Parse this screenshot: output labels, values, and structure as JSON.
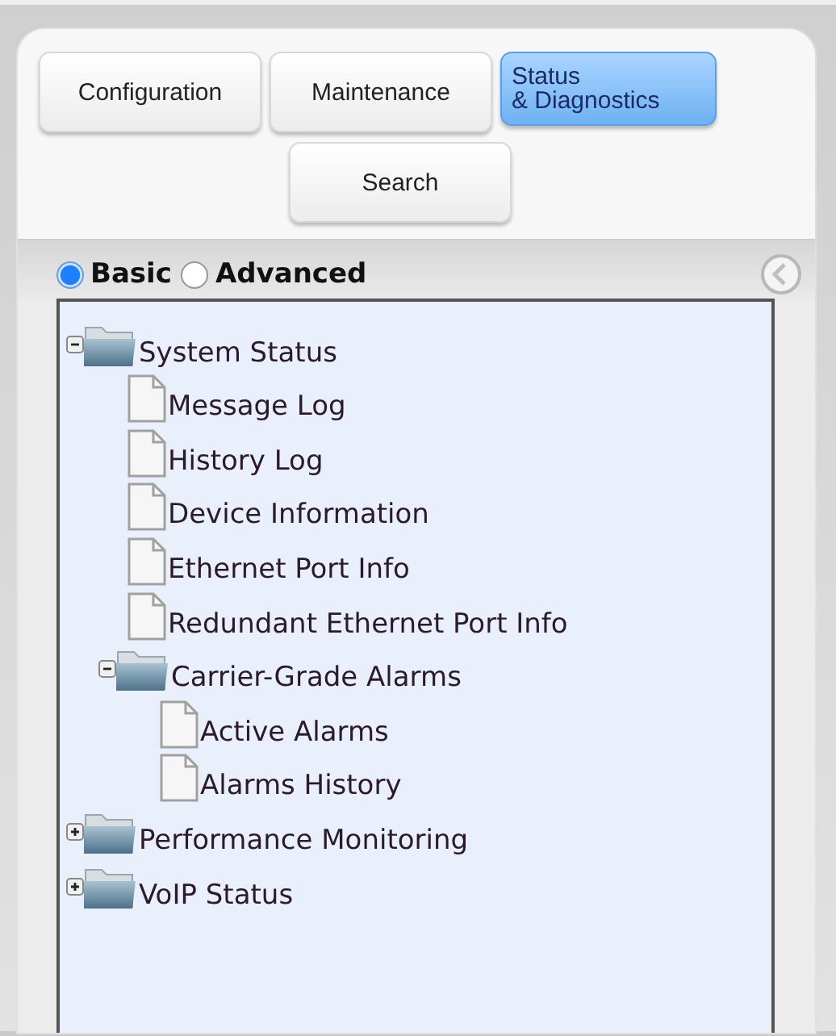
{
  "nav_buttons": [
    {
      "label": "Configuration",
      "selected": false
    },
    {
      "label": "Maintenance",
      "selected": false
    },
    {
      "label": "Status\n& Diagnostics",
      "selected": true
    },
    {
      "label": "Search",
      "selected": false
    }
  ],
  "view_mode": [
    {
      "label": "Basic",
      "selected": true
    },
    {
      "label": "Advanced",
      "selected": false
    }
  ],
  "tree": [
    {
      "kind": "folder",
      "label": "System Status",
      "expanded": true,
      "children": [
        {
          "kind": "page",
          "label": "Message Log"
        },
        {
          "kind": "page",
          "label": "History Log"
        },
        {
          "kind": "page",
          "label": "Device Information"
        },
        {
          "kind": "page",
          "label": "Ethernet Port Info"
        },
        {
          "kind": "page",
          "label": "Redundant Ethernet Port Info"
        },
        {
          "kind": "folder",
          "label": "Carrier-Grade Alarms",
          "expanded": true,
          "children": [
            {
              "kind": "page",
              "label": "Active Alarms"
            },
            {
              "kind": "page",
              "label": "Alarms History"
            }
          ]
        }
      ]
    },
    {
      "kind": "folder",
      "label": "Performance Monitoring",
      "expanded": false
    },
    {
      "kind": "folder",
      "label": "VoIP Status",
      "expanded": false
    }
  ]
}
